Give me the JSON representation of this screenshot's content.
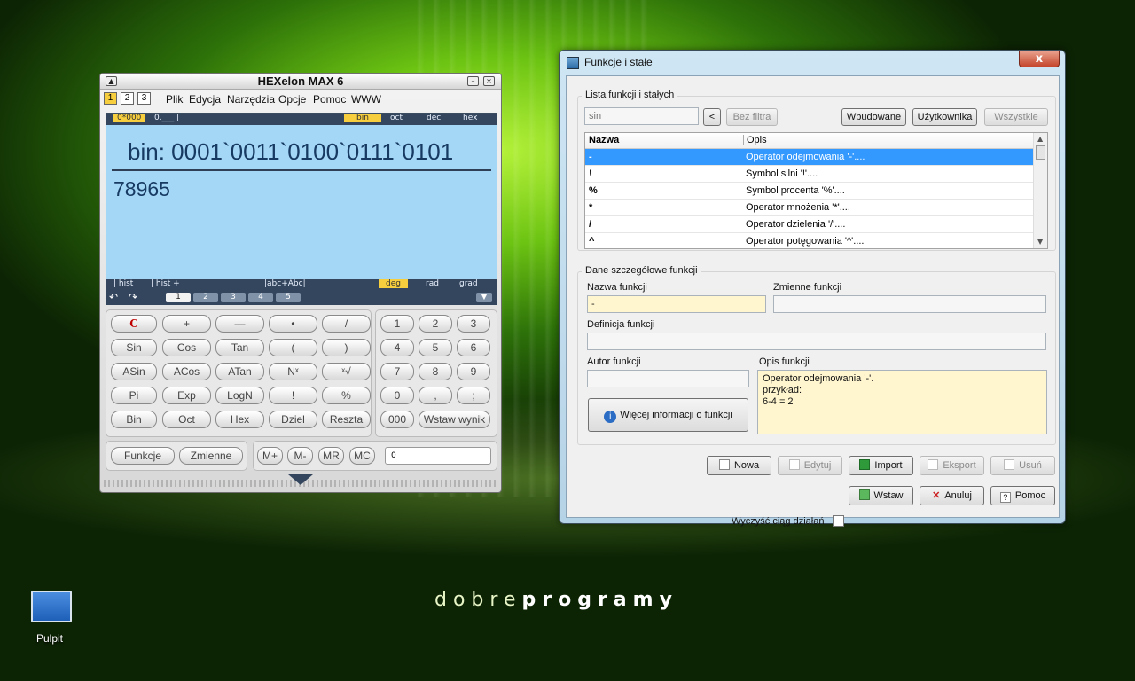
{
  "calc": {
    "title": "HEXelon MAX 6",
    "pages": [
      "1",
      "2",
      "3"
    ],
    "menu": [
      "Plik",
      "Edycja",
      "Narzędzia",
      "Opcje",
      "Pomoc",
      "WWW"
    ],
    "status_left": "0*000",
    "status_left2": "0.___ |",
    "bases": [
      "bin",
      "oct",
      "dec",
      "hex"
    ],
    "active_base": "bin",
    "display_bin": "bin: 0001`0011`0100`0111`0101",
    "display_dec": "78965",
    "foot": [
      "| hist",
      "| hist +",
      "|abc+Abc|",
      "deg",
      "rad",
      "grad"
    ],
    "active_angle": "deg",
    "nav_pages": [
      "1",
      "2",
      "3",
      "4",
      "5"
    ],
    "keys": [
      [
        "C",
        "+",
        "—",
        "•",
        "/"
      ],
      [
        "Sin",
        "Cos",
        "Tan",
        "(",
        ")"
      ],
      [
        "ASin",
        "ACos",
        "ATan",
        "Nˣ",
        "ˣ√"
      ],
      [
        "Pi",
        "Exp",
        "LogN",
        "!",
        "%"
      ],
      [
        "Bin",
        "Oct",
        "Hex",
        "Dziel",
        "Reszta"
      ]
    ],
    "numkeys": [
      [
        "1",
        "2",
        "3"
      ],
      [
        "4",
        "5",
        "6"
      ],
      [
        "7",
        "8",
        "9"
      ],
      [
        "0",
        ",",
        ";"
      ]
    ],
    "num_bottom": [
      "000",
      "Wstaw wynik"
    ],
    "func_buttons": [
      "Funkcje",
      "Zmienne"
    ],
    "mem_buttons": [
      "M+",
      "M-",
      "MR",
      "MC"
    ],
    "mem_value": "0"
  },
  "dialog": {
    "title": "Funkcje i stałe",
    "close": "x",
    "group1": "Lista funkcji i stałych",
    "filter_value": "sin",
    "back_btn": "<",
    "nofilter_btn": "Bez filtra",
    "builtin_btn": "Wbudowane",
    "user_btn": "Użytkownika",
    "all_btn": "Wszystkie",
    "col_name": "Nazwa",
    "col_desc": "Opis",
    "rows": [
      {
        "name": "-",
        "desc": "Operator odejmowania '-'...."
      },
      {
        "name": "!",
        "desc": "Symbol silni '!'...."
      },
      {
        "name": "%",
        "desc": "Symbol procenta '%'...."
      },
      {
        "name": "*",
        "desc": "Operator mnożenia '*'...."
      },
      {
        "name": "/",
        "desc": "Operator dzielenia '/'...."
      },
      {
        "name": "^",
        "desc": "Operator potęgowania '^'...."
      }
    ],
    "group2": "Dane szczegółowe funkcji",
    "lbl_name": "Nazwa funkcji",
    "name_value": "-",
    "lbl_vars": "Zmienne funkcji",
    "lbl_def": "Definicja funkcji",
    "lbl_author": "Autor funkcji",
    "lbl_desc": "Opis funkcji",
    "desc_value": "Operator odejmowania '-'.\nprzykład:\n6-4 = 2",
    "more_btn": "Więcej informacji o funkcji",
    "new_btn": "Nowa",
    "edit_btn": "Edytuj",
    "import_btn": "Import",
    "export_btn": "Eksport",
    "delete_btn": "Usuń",
    "clear_label": "Wyczyść ciąg działań",
    "insert_btn": "Wstaw",
    "cancel_btn": "Anuluj",
    "help_btn": "Pomoc"
  },
  "desktop": {
    "brand_a": "dobre",
    "brand_b": "programy",
    "icon_label": "Pulpit"
  }
}
